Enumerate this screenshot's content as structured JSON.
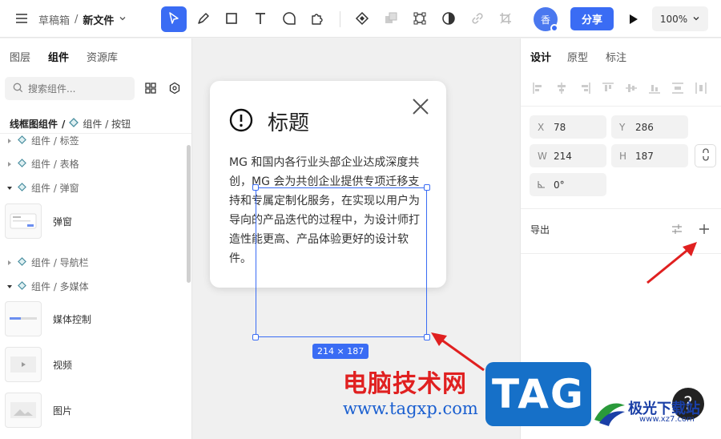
{
  "topbar": {
    "breadcrumb_parent": "草稿箱",
    "breadcrumb_sep": "/",
    "file_name": "新文件",
    "avatar_text": "香",
    "share_label": "分享",
    "zoom_value": "100%"
  },
  "left_panel": {
    "tabs": [
      {
        "label": "图层"
      },
      {
        "label": "组件"
      },
      {
        "label": "资源库"
      }
    ],
    "active_tab": "组件",
    "search_placeholder": "搜索组件...",
    "breadcrumb_root": "线框图组件",
    "breadcrumb_sep": "/",
    "breadcrumb_current": "组件 / 按钮",
    "tree": [
      {
        "label": "组件 / 标签"
      },
      {
        "label": "组件 / 表格"
      },
      {
        "label": "组件 / 弹窗"
      },
      {
        "label": "组件 / 导航栏"
      },
      {
        "label": "组件 / 多媒体"
      }
    ],
    "components": [
      {
        "label": "弹窗"
      },
      {
        "label": "媒体控制"
      },
      {
        "label": "视频"
      },
      {
        "label": "图片"
      }
    ]
  },
  "canvas": {
    "dialog_title": "标题",
    "dialog_body": "MG 和国内各行业头部企业达成深度共创，MG 会为共创企业提供专项迁移支持和专属定制化服务，在实现以用户为导向的产品迭代的过程中，为设计师打造性能更高、产品体验更好的设计软件。",
    "selection_label": "214 × 187"
  },
  "right_panel": {
    "tabs": [
      {
        "label": "设计"
      },
      {
        "label": "原型"
      },
      {
        "label": "标注"
      }
    ],
    "active_tab": "设计",
    "fields": {
      "x_key": "X",
      "x": "78",
      "y_key": "Y",
      "y": "286",
      "w_key": "W",
      "w": "214",
      "h_key": "H",
      "h": "187",
      "rotation": "0°"
    },
    "export_label": "导出"
  },
  "help_label": "?",
  "watermark": {
    "site_name": "电脑技术网",
    "url": "www.tagxp.com",
    "tag": "TAG",
    "brand": "极光下载站",
    "brand_url": "www.xz7.com"
  },
  "colors": {
    "accent": "#3a6cf4",
    "annotation_arrow": "#e02020"
  }
}
